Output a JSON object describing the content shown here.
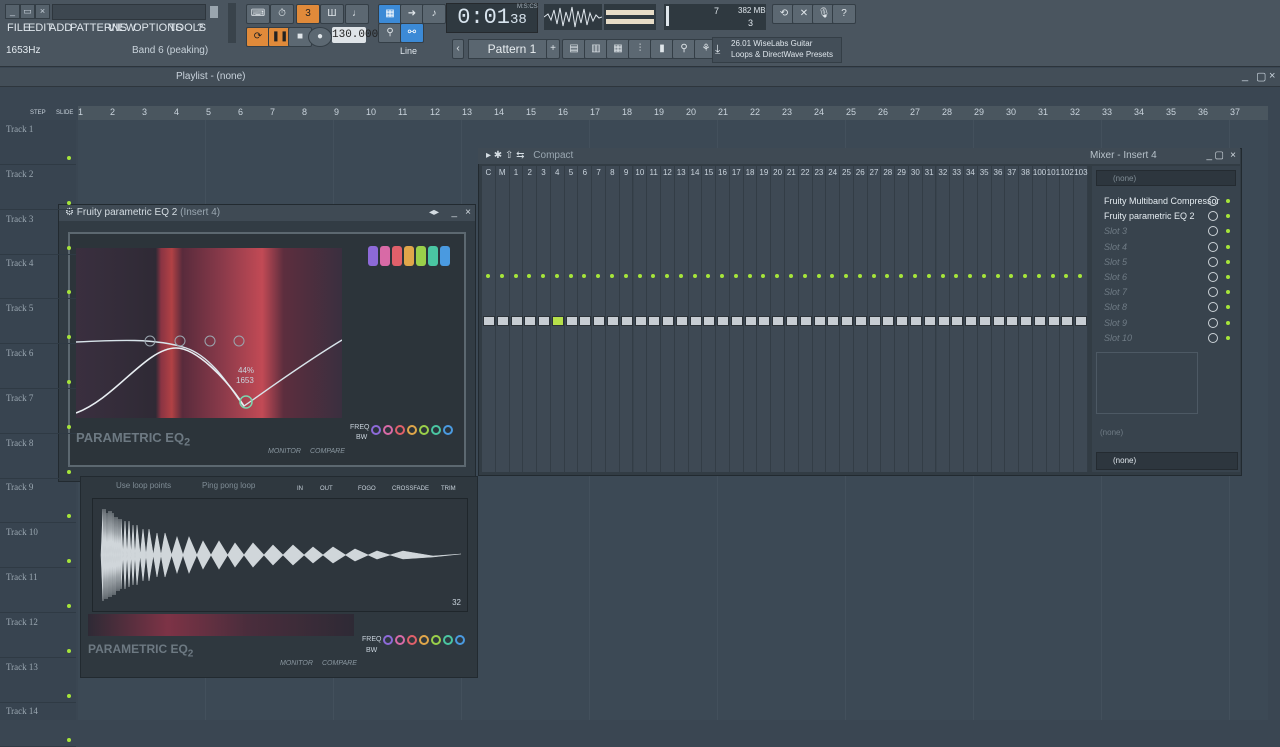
{
  "menu": {
    "items": [
      "FILE",
      "EDIT",
      "ADD",
      "PATTERNS",
      "VIEW",
      "OPTIONS",
      "TOOLS",
      "?"
    ]
  },
  "hint": {
    "value": "1653Hz",
    "band": "Band 6 (peaking)"
  },
  "transport": {
    "time": "0:01",
    "time_sub": "38",
    "time_unit": "M:S:CS",
    "bpm": "130.000",
    "pattern": "Pattern 1",
    "snap": "Line"
  },
  "cpu": {
    "value": "7",
    "memory": "382 MB",
    "polyphony": "3"
  },
  "news": {
    "line1": "26.01  WiseLabs Guitar",
    "line2": "Loops & DirectWave Presets"
  },
  "playlist": {
    "title": "Playlist - (none)",
    "step_label": "STEP",
    "slide_label": "SLIDE"
  },
  "ruler": [
    "1",
    "2",
    "3",
    "4",
    "5",
    "6",
    "7",
    "8",
    "9",
    "10",
    "11",
    "12",
    "13",
    "14",
    "15",
    "16",
    "17",
    "18",
    "19",
    "20",
    "21",
    "22",
    "23",
    "24",
    "25",
    "26",
    "27",
    "28",
    "29",
    "30",
    "31",
    "32",
    "33",
    "34",
    "35",
    "36",
    "37"
  ],
  "tracks": [
    "Track 1",
    "Track 2",
    "Track 3",
    "Track 4",
    "Track 5",
    "Track 6",
    "Track 7",
    "Track 8",
    "Track 9",
    "Track 10",
    "Track 11",
    "Track 12",
    "Track 13",
    "Track 14"
  ],
  "eq1": {
    "title": "Fruity parametric EQ 2",
    "subtitle": "(Insert 4)",
    "logo": "PARAMETRIC EQ",
    "logo_sub": "2",
    "monitor": "MONITOR",
    "compare": "COMPARE",
    "freq": "FREQ",
    "bw": "BW",
    "readout": "44%",
    "readout2": "1653"
  },
  "eq1_bands": [
    "1",
    "2",
    "3",
    "4",
    "5",
    "6",
    "7"
  ],
  "eq2": {
    "loop": "Use loop points",
    "pingpong": "Ping pong loop",
    "in": "IN",
    "out": "OUT",
    "fogo": "FOGO",
    "crossfade": "CROSSFADE",
    "trim": "TRIM",
    "count": "32",
    "logo": "PARAMETRIC EQ",
    "logo_sub": "2",
    "monitor": "MONITOR",
    "compare": "COMPARE",
    "freq": "FREQ",
    "bw": "BW"
  },
  "mixer": {
    "title": "Mixer - Insert 4",
    "view": "Compact",
    "top_none": "(none)",
    "bottom_none": "(none)",
    "bottom_none2": "(none)"
  },
  "mixer_slots": [
    {
      "label": "Fruity Multiband Compressor",
      "active": true
    },
    {
      "label": "Fruity parametric EQ 2",
      "active": true
    },
    {
      "label": "Slot 3",
      "active": false
    },
    {
      "label": "Slot 4",
      "active": false
    },
    {
      "label": "Slot 5",
      "active": false
    },
    {
      "label": "Slot 6",
      "active": false
    },
    {
      "label": "Slot 7",
      "active": false
    },
    {
      "label": "Slot 8",
      "active": false
    },
    {
      "label": "Slot 9",
      "active": false
    },
    {
      "label": "Slot 10",
      "active": false
    }
  ],
  "mixer_channels": [
    "C",
    "M",
    "1",
    "2",
    "3",
    "4",
    "5",
    "6",
    "7",
    "8",
    "9",
    "10",
    "11",
    "12",
    "13",
    "14",
    "15",
    "16",
    "17",
    "18",
    "19",
    "20",
    "21",
    "22",
    "23",
    "24",
    "25",
    "26",
    "27",
    "28",
    "29",
    "30",
    "31",
    "32",
    "33",
    "34",
    "35",
    "36",
    "37",
    "38",
    "100",
    "101",
    "102",
    "103"
  ],
  "colors": {
    "accent_green": "#a6e53a",
    "accent_orange": "#e08a3a",
    "accent_blue": "#3c8ad6"
  }
}
